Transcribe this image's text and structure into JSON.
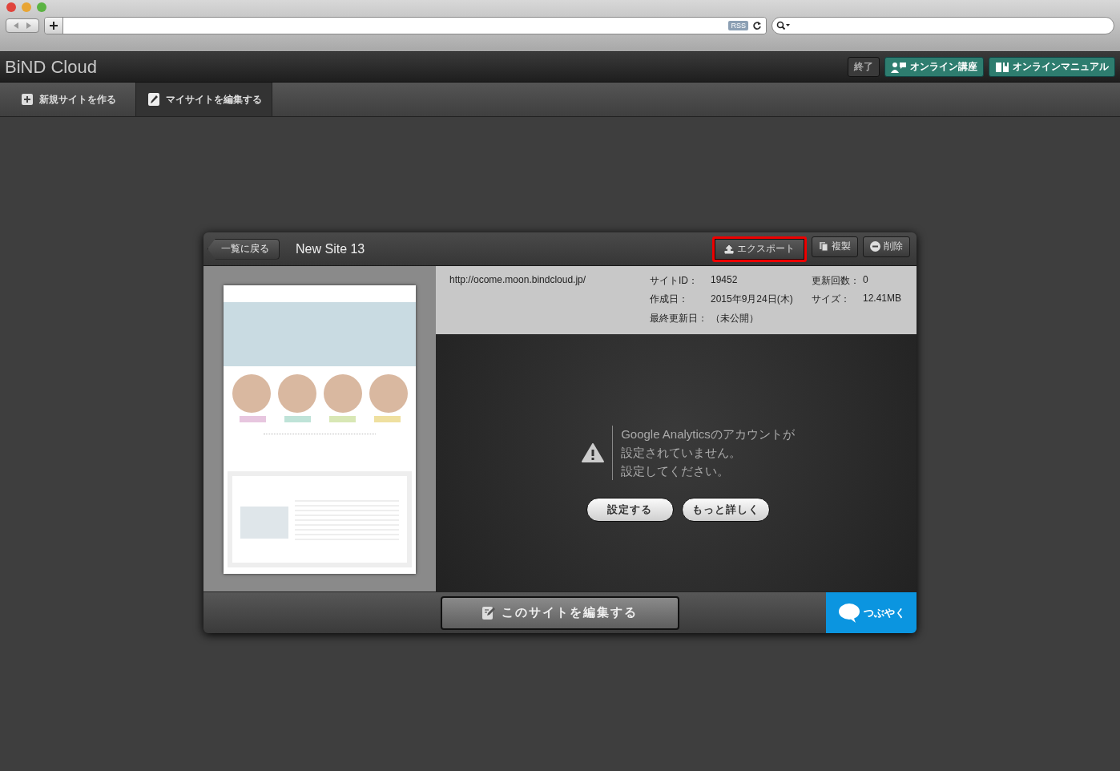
{
  "browser": {
    "rss_label": "RSS"
  },
  "app_header": {
    "title": "BiND Cloud",
    "buttons": [
      {
        "label": "終了",
        "kind": "plain"
      },
      {
        "label": "オンライン講座",
        "kind": "course"
      },
      {
        "label": "オンラインマニュアル",
        "kind": "manual"
      }
    ]
  },
  "toolbar": {
    "tabs": [
      {
        "label": "新規サイトを作る",
        "kind": "new",
        "selected": false
      },
      {
        "label": "マイサイトを編集する",
        "kind": "edit",
        "selected": true
      }
    ]
  },
  "site_panel": {
    "back_button": "一覧に戻る",
    "site_name": "New Site 13",
    "actions": [
      {
        "label": "エクスポート",
        "kind": "export",
        "highlighted": true
      },
      {
        "label": "複製",
        "kind": "duplicate",
        "highlighted": false
      },
      {
        "label": "削除",
        "kind": "delete",
        "highlighted": false
      }
    ],
    "url": "http://ocome.moon.bindcloud.jp/",
    "details": [
      {
        "label": "サイトID：",
        "value": "19452"
      },
      {
        "label": "更新回数：",
        "value": "0"
      },
      {
        "label": "作成日：",
        "value": "2015年9月24日(木)"
      },
      {
        "label": "サイズ：",
        "value": "12.41MB"
      },
      {
        "label": "最終更新日：",
        "value": "（未公開）"
      }
    ],
    "notice": [
      "Google Analyticsのアカウントが",
      "設定されていません。",
      "設定してください。"
    ],
    "notice_buttons": [
      "設定する",
      "もっと詳しく"
    ],
    "edit_button": "このサイトを編集する",
    "tweet_button": "つぶやく"
  }
}
